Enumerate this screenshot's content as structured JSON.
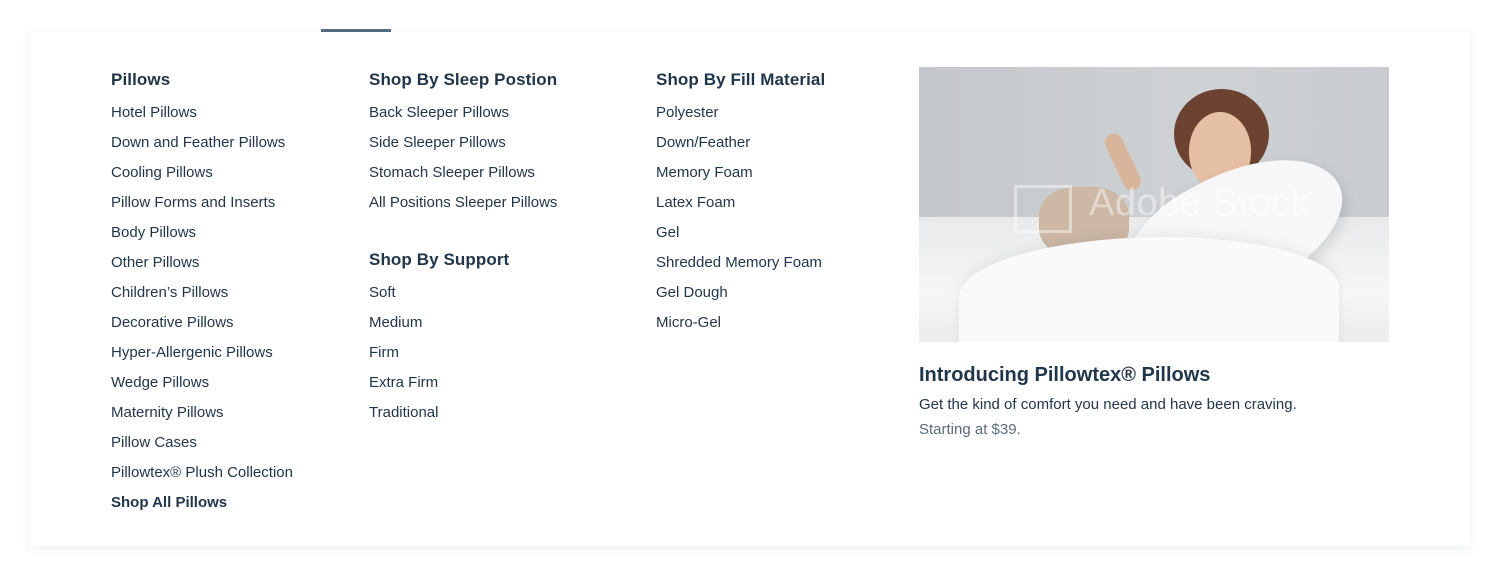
{
  "colors": {
    "text": "#22364a",
    "muted": "#5b6b7b",
    "indicator": "#5a6f84"
  },
  "pillows": {
    "heading": "Pillows",
    "items": [
      "Hotel Pillows",
      "Down and Feather Pillows",
      "Cooling Pillows",
      "Pillow Forms and Inserts",
      "Body Pillows",
      "Other Pillows",
      "Children’s Pillows",
      "Decorative Pillows",
      "Hyper-Allergenic Pillows",
      "Wedge Pillows",
      "Maternity Pillows",
      "Pillow Cases",
      "Pillowtex® Plush Collection"
    ],
    "shop_all": "Shop All Pillows"
  },
  "sleep_position": {
    "heading": "Shop By Sleep Postion",
    "items": [
      "Back Sleeper Pillows",
      "Side Sleeper Pillows",
      "Stomach Sleeper Pillows",
      "All Positions Sleeper Pillows"
    ]
  },
  "support": {
    "heading": "Shop By Support",
    "items": [
      "Soft",
      "Medium",
      "Firm",
      "Extra Firm",
      "Traditional"
    ]
  },
  "fill_material": {
    "heading": "Shop By Fill Material",
    "items": [
      "Polyester",
      "Down/Feather",
      "Memory Foam",
      "Latex Foam",
      "Gel",
      "Shredded Memory Foam",
      "Gel Dough",
      "Micro-Gel"
    ]
  },
  "promo": {
    "image_watermark": "Adobe Stock",
    "title": "Introducing Pillowtex® Pillows",
    "description": "Get the kind of comfort you need and have been craving.",
    "price": "Starting at $39."
  }
}
